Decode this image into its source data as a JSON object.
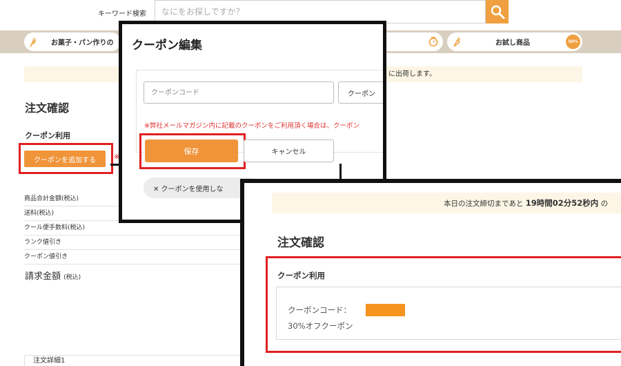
{
  "header": {
    "keyword_label": "キーワード検索",
    "search_placeholder": "なにをお探しですか？"
  },
  "nav": {
    "left_label": "お菓子・パン作りの",
    "right_label": "お試し商品",
    "badge": "50%"
  },
  "notice": {
    "text": "に出荷します。"
  },
  "page": {
    "title": "注文確認",
    "coupon_section_label": "クーポン利用",
    "add_coupon_button": "クーポンを追加する",
    "asterisk": "※"
  },
  "summary": {
    "rows": [
      "商品合計金額(税込)",
      "送料(税込)",
      "クール便手数料(税込)",
      "ランク値引き",
      "クーポン値引き"
    ],
    "total_label": "請求金額",
    "total_suffix": "(税込)"
  },
  "order_detail": {
    "label": "注文詳細1"
  },
  "modal": {
    "title": "クーポン編集",
    "code_placeholder": "クーポンコード",
    "apply_button": "クーポン",
    "note": "※弊社メールマガジン内に記載のクーポンをご利用頂く場合は、クーポン",
    "save_button": "保存",
    "cancel_button": "キャンセル",
    "no_use_button": "✕ クーポンを使用しな"
  },
  "result": {
    "deadline_prefix": "本日の注文締切まであと",
    "deadline_time": "19時間02分52秒内",
    "deadline_suffix": "の",
    "title": "注文確認",
    "coupon_label": "クーポン利用",
    "coupon_code_label": "クーポンコード：",
    "coupon_name": "30%オフクーポン"
  },
  "colors": {
    "accent_orange": "#f0943a",
    "highlight_red": "#e02020",
    "nav_bg": "#d8cfc0",
    "notice_bg": "#fdf6e6"
  }
}
